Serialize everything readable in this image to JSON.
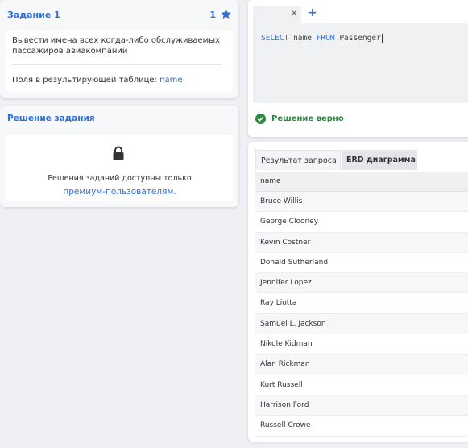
{
  "task": {
    "title": "Задание 1",
    "count": "1",
    "description": "Вывести имена всех когда-либо обслуживаемых пассажиров авиакомпаний",
    "fields_label": "Поля в результирующей таблице:",
    "fields_value": "name"
  },
  "solution": {
    "title": "Решение задания",
    "premium_text": "Решения заданий доступны только",
    "premium_link": "премиум-пользователям."
  },
  "editor": {
    "tab_close": "×",
    "tab_add": "+",
    "code_keyword_select": "SELECT",
    "code_column": "name",
    "code_keyword_from": "FROM",
    "code_table": "Passenger",
    "status": "Решение верно"
  },
  "results": {
    "tab_result": "Результат запроса",
    "tab_erd": "ERD диаграмма",
    "column_header": "name",
    "rows": [
      "Bruce Willis",
      "George Clooney",
      "Kevin Costner",
      "Donald Sutherland",
      "Jennifer Lopez",
      "Ray Liotta",
      "Samuel L. Jackson",
      "Nikole Kidman",
      "Alan Rickman",
      "Kurt Russell",
      "Harrison Ford",
      "Russell Crowe"
    ]
  },
  "colors": {
    "accent": "#2f6fd6",
    "success": "#2a8a3e"
  },
  "icons": {
    "star": "star-icon",
    "lock": "lock-icon",
    "check": "check-circle-icon"
  }
}
